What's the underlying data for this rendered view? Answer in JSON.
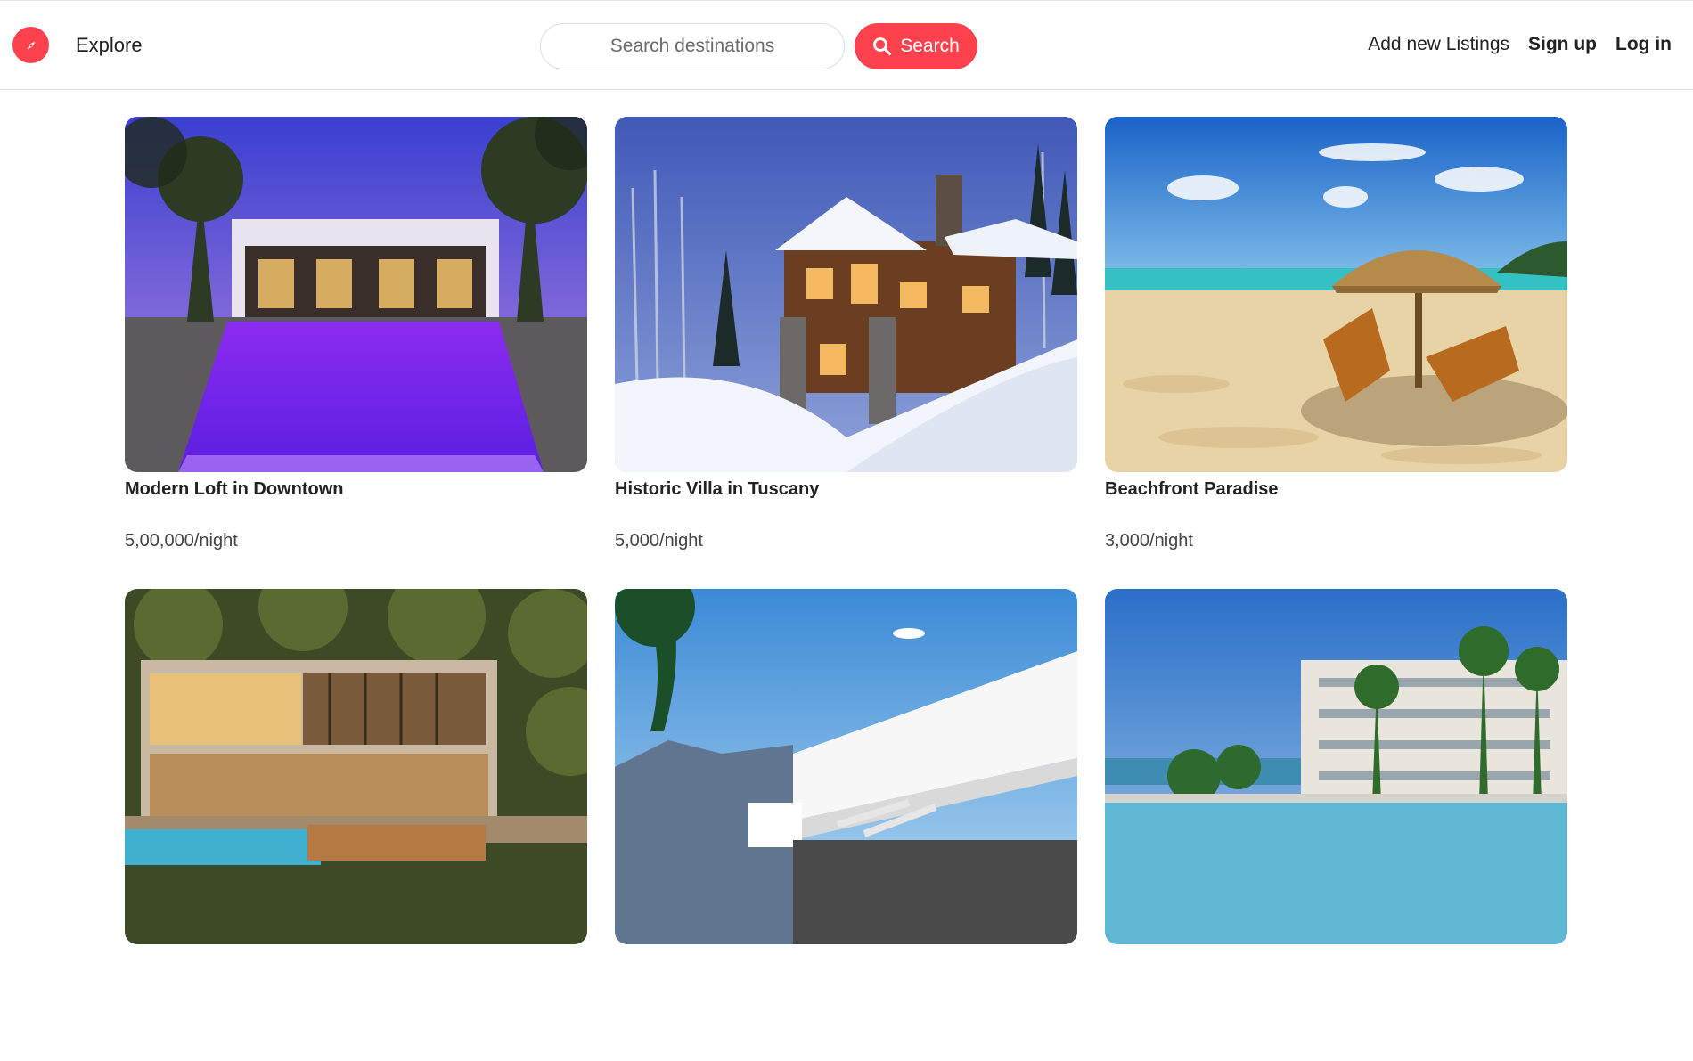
{
  "navbar": {
    "logo_icon": "compass-icon",
    "brand_color": "#fe424d",
    "explore_label": "Explore",
    "search": {
      "placeholder": "Search destinations",
      "value": "",
      "button_label": "Search",
      "button_icon": "search-icon"
    },
    "add_listing_label": "Add new Listings",
    "signup_label": "Sign up",
    "login_label": "Log in"
  },
  "listings": [
    {
      "title": "Modern Loft in Downtown",
      "price": "5,00,000/night",
      "image": "luxury-villa-with-purple-lit-pool"
    },
    {
      "title": "Historic Villa in Tuscany",
      "price": "5,000/night",
      "image": "snow-covered-mountain-lodge"
    },
    {
      "title": "Beachfront Paradise",
      "price": "3,000/night",
      "image": "beach-umbrella-with-lounge-chairs"
    },
    {
      "title": "",
      "price": "",
      "image": "modern-glass-house-with-pool"
    },
    {
      "title": "",
      "price": "",
      "image": "white-modern-villa-with-palms"
    },
    {
      "title": "",
      "price": "",
      "image": "resort-with-infinity-pool"
    }
  ]
}
